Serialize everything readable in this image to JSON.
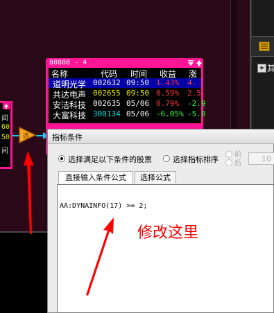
{
  "left_widget": {
    "rows": [
      "间",
      "60",
      "50",
      "间"
    ]
  },
  "stock_widget": {
    "title": "88888 - 4",
    "columns": [
      "名称",
      "代码",
      "时间",
      "收益",
      "涨"
    ],
    "rows": [
      {
        "name": "道明光学",
        "code": "002632",
        "time": "09:50",
        "gain": "1.43%",
        "extra": "4.",
        "name_color": "#ffffff",
        "code_color": "#ffffff",
        "time_color": "#ffffff",
        "gain_color": "#ff3333",
        "extra_color": "#ff3333",
        "selected": true
      },
      {
        "name": "共达电声",
        "code": "002655",
        "time": "09:50",
        "gain": "0.59%",
        "extra": "2.5",
        "name_color": "#ffffff",
        "code_color": "#e8e800",
        "time_color": "#e8e800",
        "gain_color": "#ff3333",
        "extra_color": "#ff3333",
        "selected": false
      },
      {
        "name": "安洁科技",
        "code": "002635",
        "time": "05/06",
        "gain": "0.79%",
        "extra": "-2.9",
        "name_color": "#ffffff",
        "code_color": "#ffffff",
        "time_color": "#ffffff",
        "gain_color": "#ff3333",
        "extra_color": "#33ff33",
        "selected": false
      },
      {
        "name": "大富科技",
        "code": "300134",
        "time": "05/06",
        "gain": "-6.05%",
        "extra": "-5.8",
        "name_color": "#ffffff",
        "code_color": "#00e0e0",
        "time_color": "#ffffff",
        "gain_color": "#33ff33",
        "extra_color": "#33ff33",
        "selected": false
      }
    ]
  },
  "right_panel": {
    "label": "其"
  },
  "dialog": {
    "title": "指标条件",
    "option_satisfy": "选择满足以下条件的股票",
    "option_sort": "选择指标排序",
    "sort_front": "前",
    "sort_after": "后",
    "count_value": "10",
    "tab_direct": "直接输入条件公式",
    "tab_select": "选择公式",
    "formula": "AA:DYNAINFO(17) >= 2;"
  },
  "annotation": {
    "text": "修改这里",
    "color": "#ff0000"
  },
  "colors": {
    "widget_border": "#ff1493",
    "connector": "#1ec8ff",
    "workspace_bg": "#2a0818"
  }
}
